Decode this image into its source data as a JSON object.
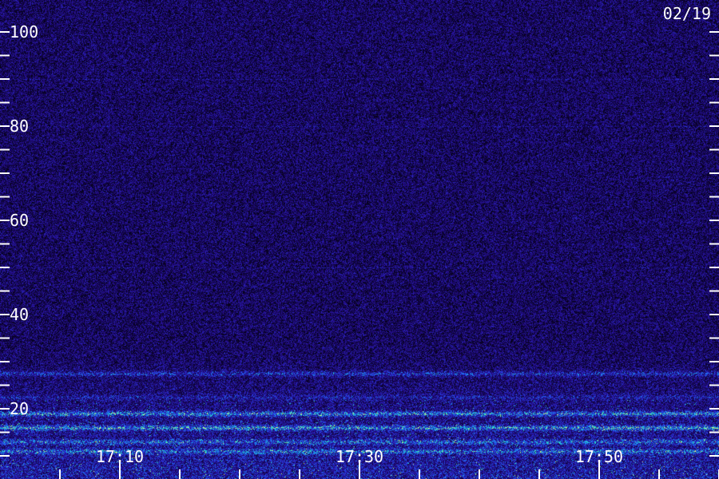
{
  "date_label": "02/19",
  "chart_data": {
    "type": "heatmap",
    "title": "",
    "xlabel": "",
    "ylabel": "",
    "x_tick_labels": [
      "17:10",
      "17:30",
      "17:50"
    ],
    "x_range": [
      "17:02",
      "18:02"
    ],
    "x_minor_tick_minutes": 5,
    "ylim": [
      10,
      105
    ],
    "y_tick_labels": [
      "20",
      "40",
      "60",
      "80",
      "100"
    ],
    "y_ticks_all": [
      10,
      15,
      20,
      25,
      30,
      35,
      40,
      45,
      50,
      55,
      60,
      65,
      70,
      75,
      80,
      85,
      90,
      95,
      100
    ],
    "colors": {
      "background_noise": "#1c0c8c",
      "band_cyan": "#1ec8e6",
      "band_green": "#3cf0a0",
      "axis_text": "#ffffff"
    },
    "bands": [
      {
        "y": 27.5,
        "strength": "medium"
      },
      {
        "y": 22.5,
        "strength": "weak"
      },
      {
        "y": 19,
        "strength": "strong"
      },
      {
        "y": 16,
        "strength": "strong"
      },
      {
        "y": 13,
        "strength": "medium"
      },
      {
        "y": 11,
        "strength": "medium"
      }
    ]
  }
}
